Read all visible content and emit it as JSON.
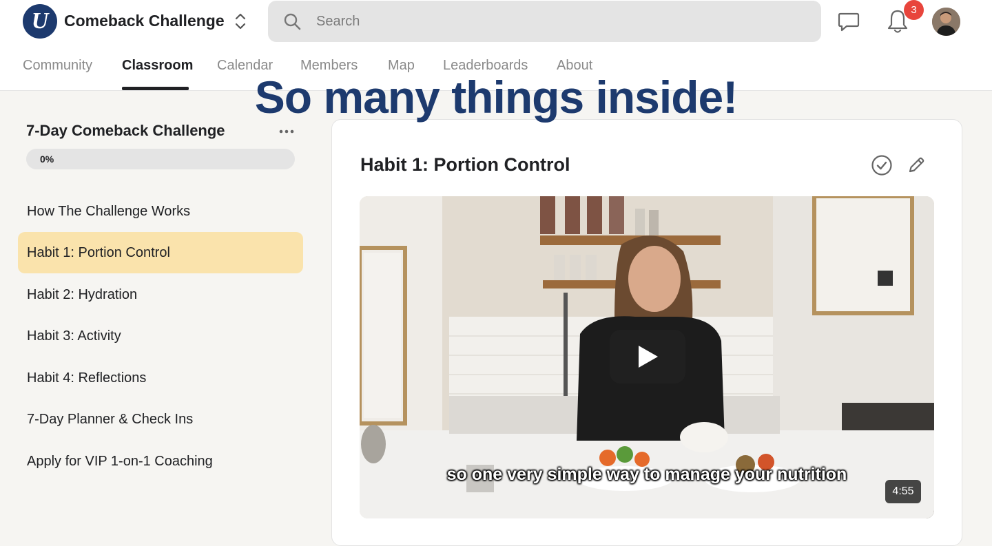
{
  "header": {
    "community_name": "Comeback Challenge",
    "logo_letter": "U",
    "search": {
      "placeholder": "Search"
    },
    "notifications_count": "3",
    "colors": {
      "brand": "#1d3a6e",
      "badge": "#e8453c"
    }
  },
  "tabs": [
    {
      "label": "Community",
      "active": false
    },
    {
      "label": "Classroom",
      "active": true
    },
    {
      "label": "Calendar",
      "active": false
    },
    {
      "label": "Members",
      "active": false
    },
    {
      "label": "Map",
      "active": false
    },
    {
      "label": "Leaderboards",
      "active": false
    },
    {
      "label": "About",
      "active": false
    }
  ],
  "overlay": {
    "text": "So many things inside!"
  },
  "course": {
    "title": "7-Day Comeback Challenge",
    "progress_label": "0%",
    "progress_fraction": 0,
    "lessons": [
      {
        "label": "How The Challenge Works",
        "active": false
      },
      {
        "label": "Habit 1: Portion Control",
        "active": true
      },
      {
        "label": "Habit 2: Hydration",
        "active": false
      },
      {
        "label": "Habit 3: Activity",
        "active": false
      },
      {
        "label": "Habit 4: Reflections",
        "active": false
      },
      {
        "label": "7-Day Planner & Check Ins",
        "active": false
      },
      {
        "label": "Apply for VIP 1-on-1 Coaching",
        "active": false
      }
    ]
  },
  "lesson": {
    "title": "Habit 1: Portion Control",
    "video": {
      "caption": "so one very simple way to manage your nutrition",
      "duration": "4:55"
    }
  },
  "icons": [
    "logo-icon",
    "switcher-chevrons-icon",
    "search-icon",
    "chat-icon",
    "bell-icon",
    "avatar",
    "more-dots-icon",
    "check-circle-icon",
    "pencil-icon",
    "play-icon"
  ]
}
